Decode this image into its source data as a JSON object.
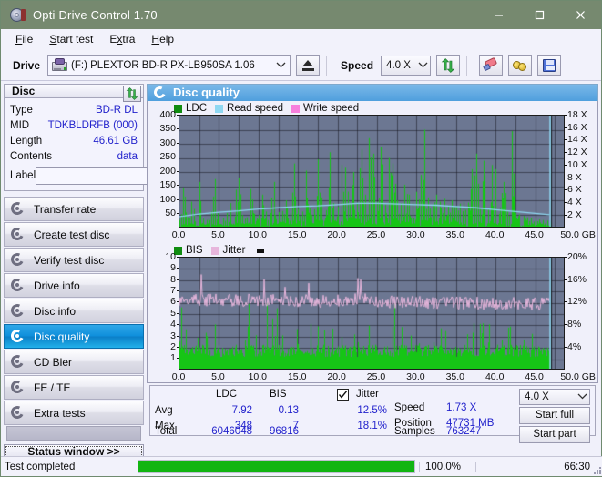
{
  "window": {
    "title": "Opti Drive Control 1.70",
    "icon": "disc-icon",
    "minimize": "minimize-icon",
    "maximize": "maximize-icon",
    "close": "close-icon"
  },
  "menu": [
    {
      "label": "File",
      "accel": "F"
    },
    {
      "label": "Start test",
      "accel": "S"
    },
    {
      "label": "Extra",
      "accel": "x"
    },
    {
      "label": "Help",
      "accel": "H"
    }
  ],
  "toolbar": {
    "drive_label": "Drive",
    "drive_value": "(F:)  PLEXTOR BD-R  PX-LB950SA 1.06",
    "drive_icon": "optical-drive-icon",
    "eject_icon": "eject-icon",
    "speed_label": "Speed",
    "speed_value": "4.0 X",
    "refresh_icon": "refresh-icon",
    "erase_icon": "eraser-icon",
    "tools_icon": "binoculars-icon",
    "save_icon": "floppy-save-icon"
  },
  "disc_panel": {
    "title": "Disc",
    "refresh_icon": "refresh-icon",
    "rows": [
      {
        "key": "Type",
        "value": "BD-R DL"
      },
      {
        "key": "MID",
        "value": "TDKBLDRFB (000)"
      },
      {
        "key": "Length",
        "value": "46.61 GB"
      },
      {
        "key": "Contents",
        "value": "data"
      }
    ],
    "label_key": "Label",
    "label_value": "",
    "label_placeholder": "",
    "label_button_icon": "cd-disc-icon"
  },
  "nav": {
    "items": [
      {
        "label": "Transfer rate",
        "icon": "disc-transfer-icon",
        "active": false
      },
      {
        "label": "Create test disc",
        "icon": "disc-create-icon",
        "active": false
      },
      {
        "label": "Verify test disc",
        "icon": "disc-verify-icon",
        "active": false
      },
      {
        "label": "Drive info",
        "icon": "disc-drive-icon",
        "active": false
      },
      {
        "label": "Disc info",
        "icon": "disc-info-icon",
        "active": false
      },
      {
        "label": "Disc quality",
        "icon": "disc-quality-icon",
        "active": true
      },
      {
        "label": "CD Bler",
        "icon": "disc-bler-icon",
        "active": false
      },
      {
        "label": "FE / TE",
        "icon": "disc-fete-icon",
        "active": false
      },
      {
        "label": "Extra tests",
        "icon": "disc-extra-icon",
        "active": false
      }
    ],
    "status_window_button": "Status window >>"
  },
  "content": {
    "title": "Disc quality",
    "title_icon": "disc-quality-icon"
  },
  "stats": {
    "col_ldc": "LDC",
    "col_bis": "BIS",
    "row_avg": "Avg",
    "row_max": "Max",
    "row_total": "Total",
    "ldc_avg": "7.92",
    "ldc_max": "348",
    "ldc_total": "6046048",
    "bis_avg": "0.13",
    "bis_max": "7",
    "bis_total": "96816",
    "jitter_label": "Jitter",
    "jitter_checked": "✓",
    "jitter_avg": "12.5%",
    "jitter_max": "18.1%",
    "speed_label": "Speed",
    "speed_value": "1.73 X",
    "position_label": "Position",
    "position_value": "47731 MB",
    "samples_label": "Samples",
    "samples_value": "763247",
    "speed_select": "4.0 X",
    "start_full": "Start full",
    "start_part": "Start part"
  },
  "statusbar": {
    "text": "Test completed",
    "percent": "100.0%",
    "progress": 100,
    "time": "66:30"
  },
  "colors": {
    "title_bar": "#76896f",
    "accent_blue": "#2222cc",
    "plot_bg": "#6c7792",
    "ldc_green": "#16c516",
    "read_speed": "#8fd8f2",
    "write_speed": "#f77fdc",
    "jitter_pink": "#e7b6dc",
    "progress_green": "#12b512",
    "nav_active": "#0f8fdc"
  },
  "chart_data": [
    {
      "type": "line",
      "title": "LDC / Read speed / Write speed",
      "xlabel": "GB",
      "ylabel": "LDC",
      "xlim": [
        0,
        50
      ],
      "ylim": [
        0,
        400
      ],
      "y2lim": [
        0,
        18
      ],
      "y2label": "X",
      "grid": true,
      "legend": [
        "LDC",
        "Read speed",
        "Write speed"
      ],
      "legend_position": "top-left",
      "xticks": [
        "0.0",
        "5.0",
        "10.0",
        "15.0",
        "20.0",
        "25.0",
        "30.0",
        "35.0",
        "40.0",
        "45.0",
        "50.0"
      ],
      "yticks": [
        50,
        100,
        150,
        200,
        250,
        300,
        350,
        400
      ],
      "y2ticks": [
        "2 X",
        "4 X",
        "6 X",
        "8 X",
        "10 X",
        "12 X",
        "14 X",
        "16 X",
        "18 X"
      ],
      "data_end_gb": 46.9,
      "series": [
        {
          "name": "LDC",
          "color": "#16c516",
          "x": [
            0.0,
            0.5,
            1.0,
            1.5,
            2.0,
            2.5,
            3.0,
            3.5,
            4.0,
            4.5,
            5.0,
            5.5,
            6.0,
            6.5,
            7.0,
            7.5,
            8.0,
            8.5,
            9.0,
            9.5,
            10.0,
            10.5,
            11.0,
            11.5,
            12.0,
            12.5,
            13.0,
            13.5,
            14.0,
            14.5,
            15.0,
            15.5,
            16.0,
            16.5,
            17.0,
            17.5,
            18.0,
            18.5,
            19.0,
            19.5,
            20.0,
            20.5,
            21.0,
            21.5,
            22.0,
            22.5,
            23.0,
            23.5,
            24.0,
            24.5,
            25.0,
            25.5,
            26.0,
            26.5,
            27.0,
            27.5,
            28.0,
            28.5,
            29.0,
            29.5,
            30.0,
            30.5,
            31.0,
            31.5,
            32.0,
            32.5,
            33.0,
            33.5,
            34.0,
            34.5,
            35.0,
            35.5,
            36.0,
            36.5,
            37.0,
            37.5,
            38.0,
            38.5,
            39.0,
            39.5,
            40.0,
            40.5,
            41.0,
            41.5,
            42.0,
            42.5,
            43.0,
            43.5,
            44.0,
            44.5,
            45.0,
            45.5,
            46.0,
            46.5,
            46.9
          ],
          "values": [
            30,
            145,
            40,
            95,
            25,
            165,
            35,
            30,
            60,
            175,
            45,
            38,
            55,
            90,
            42,
            180,
            48,
            40,
            140,
            52,
            48,
            120,
            60,
            55,
            165,
            58,
            62,
            100,
            55,
            230,
            70,
            60,
            205,
            72,
            68,
            245,
            110,
            65,
            270,
            90,
            78,
            225,
            215,
            88,
            200,
            92,
            280,
            120,
            320,
            265,
            95,
            290,
            85,
            250,
            230,
            100,
            90,
            155,
            120,
            95,
            130,
            190,
            350,
            110,
            85,
            120,
            95,
            105,
            82,
            100,
            78,
            88,
            95,
            92,
            210,
            265,
            70,
            240,
            68,
            225,
            210,
            75,
            165,
            60,
            345,
            55,
            50,
            45,
            40,
            38,
            35,
            32,
            30,
            28,
            25
          ]
        },
        {
          "name": "Read speed",
          "color": "#8fd8f2",
          "x": [
            0.0,
            2.5,
            5.0,
            7.5,
            10.0,
            12.5,
            15.0,
            17.5,
            20.0,
            22.5,
            25.0,
            27.5,
            30.0,
            32.5,
            35.0,
            37.5,
            40.0,
            42.5,
            45.0,
            46.8,
            46.9
          ],
          "values_x": [
            1.9,
            2.3,
            2.6,
            2.8,
            3.1,
            3.3,
            3.5,
            3.6,
            3.8,
            4.0,
            4.0,
            3.9,
            3.8,
            3.7,
            3.5,
            3.3,
            3.0,
            2.7,
            2.4,
            2.2,
            18.0
          ]
        },
        {
          "name": "Write speed",
          "color": "#f77fdc",
          "x": [],
          "values": []
        }
      ]
    },
    {
      "type": "line",
      "title": "BIS / Jitter",
      "xlabel": "GB",
      "ylabel": "BIS",
      "xlim": [
        0,
        50
      ],
      "ylim": [
        0,
        10
      ],
      "y2lim": [
        0,
        20
      ],
      "y2label": "%",
      "grid": true,
      "legend": [
        "BIS",
        "Jitter"
      ],
      "legend_position": "top-left",
      "xticks": [
        "0.0",
        "5.0",
        "10.0",
        "15.0",
        "20.0",
        "25.0",
        "30.0",
        "35.0",
        "40.0",
        "45.0",
        "50.0"
      ],
      "yticks": [
        1,
        2,
        3,
        4,
        5,
        6,
        7,
        8,
        9,
        10
      ],
      "y2ticks": [
        "4%",
        "8%",
        "12%",
        "16%",
        "20%"
      ],
      "data_end_gb": 46.9,
      "series": [
        {
          "name": "BIS",
          "color": "#16c516",
          "baseline": 2,
          "spikes_max": 7
        },
        {
          "name": "Jitter",
          "color": "#e7b6dc",
          "mean_percent": 12.5,
          "max_percent": 18.1,
          "band_low": 11.5,
          "band_high": 14.5
        }
      ]
    }
  ]
}
